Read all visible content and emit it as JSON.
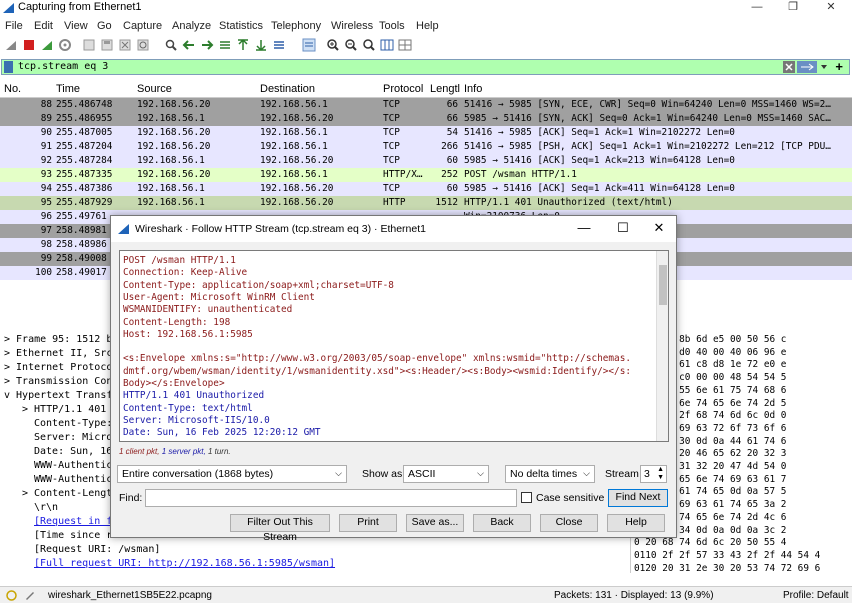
{
  "window": {
    "title": "Capturing from Ethernet1",
    "controls": [
      "—",
      "❐",
      "✕"
    ]
  },
  "menu": [
    "File",
    "Edit",
    "View",
    "Go",
    "Capture",
    "Analyze",
    "Statistics",
    "Telephony",
    "Wireless",
    "Tools",
    "Help"
  ],
  "toolbar_icons": [
    "shark-fin-icon",
    "stop-icon",
    "restart-icon",
    "options-gear-icon",
    "open-file-icon",
    "save-icon",
    "close-file-icon",
    "reload-icon",
    "find-icon",
    "back-icon",
    "forward-icon",
    "goto-icon",
    "first-icon",
    "last-icon",
    "autoscroll-icon",
    "colorize-icon",
    "zoom-in-icon",
    "zoom-out-icon",
    "zoom-normal-icon",
    "resize-columns-icon",
    "layout-icon"
  ],
  "filter": {
    "value": "tcp.stream eq 3",
    "plus": "+"
  },
  "columns": [
    "No.",
    "Time",
    "Source",
    "Destination",
    "Protocol",
    "Lengtl",
    "Info"
  ],
  "packets": [
    {
      "no": "88",
      "time": "255.486748",
      "src": "192.168.56.20",
      "dst": "192.168.56.1",
      "proto": "TCP",
      "len": "66",
      "info": "51416 → 5985 [SYN, ECE, CWR] Seq=0 Win=64240 Len=0 MSS=1460 WS=2…",
      "bg": "#a0a0a0"
    },
    {
      "no": "89",
      "time": "255.486955",
      "src": "192.168.56.1",
      "dst": "192.168.56.20",
      "proto": "TCP",
      "len": "66",
      "info": "5985 → 51416 [SYN, ACK] Seq=0 Ack=1 Win=64240 Len=0 MSS=1460 SAC…",
      "bg": "#a0a0a0"
    },
    {
      "no": "90",
      "time": "255.487005",
      "src": "192.168.56.20",
      "dst": "192.168.56.1",
      "proto": "TCP",
      "len": "54",
      "info": "51416 → 5985 [ACK] Seq=1 Ack=1 Win=2102272 Len=0",
      "bg": "#e7e6ff"
    },
    {
      "no": "91",
      "time": "255.487204",
      "src": "192.168.56.20",
      "dst": "192.168.56.1",
      "proto": "TCP",
      "len": "266",
      "info": "51416 → 5985 [PSH, ACK] Seq=1 Ack=1 Win=2102272 Len=212 [TCP PDU…",
      "bg": "#e7e6ff"
    },
    {
      "no": "92",
      "time": "255.487284",
      "src": "192.168.56.1",
      "dst": "192.168.56.20",
      "proto": "TCP",
      "len": "60",
      "info": "5985 → 51416 [ACK] Seq=1 Ack=213 Win=64128 Len=0",
      "bg": "#e7e6ff"
    },
    {
      "no": "93",
      "time": "255.487335",
      "src": "192.168.56.20",
      "dst": "192.168.56.1",
      "proto": "HTTP/X…",
      "len": "252",
      "info": "POST /wsman HTTP/1.1",
      "bg": "#e4ffc7"
    },
    {
      "no": "94",
      "time": "255.487386",
      "src": "192.168.56.1",
      "dst": "192.168.56.20",
      "proto": "TCP",
      "len": "60",
      "info": "5985 → 51416 [ACK] Seq=1 Ack=411 Win=64128 Len=0",
      "bg": "#e7e6ff"
    },
    {
      "no": "95",
      "time": "255.487929",
      "src": "192.168.56.1",
      "dst": "192.168.56.20",
      "proto": "HTTP",
      "len": "1512",
      "info": "HTTP/1.1 401 Unauthorized  (text/html)",
      "bg": "#c7d9b0"
    },
    {
      "no": "96",
      "time": "255.49761",
      "src": "",
      "dst": "",
      "proto": "",
      "len": "",
      "info": "Win=2100736 Len=0",
      "bg": "#e7e6ff"
    },
    {
      "no": "97",
      "time": "258.48981",
      "src": "",
      "dst": "",
      "proto": "",
      "len": "",
      "info": "=411 Win=64128 Len=0",
      "bg": "#a0a0a0"
    },
    {
      "no": "98",
      "time": "258.48986",
      "src": "",
      "dst": "",
      "proto": "",
      "len": "",
      "info": "Win=2100736 Len=0",
      "bg": "#e7e6ff"
    },
    {
      "no": "99",
      "time": "258.49008",
      "src": "",
      "dst": "",
      "proto": "",
      "len": "",
      "info": "1460 Win=2100736 Len=0",
      "bg": "#a0a0a0"
    },
    {
      "no": "100",
      "time": "258.49017",
      "src": "",
      "dst": "",
      "proto": "",
      "len": "",
      "info": "Win=64128 Len=0",
      "bg": "#e7e6ff"
    }
  ],
  "details": [
    {
      "t": "> Frame 95: 1512 b",
      "x": 4
    },
    {
      "t": "> Ethernet II, Src",
      "x": 4
    },
    {
      "t": "> Internet Protoco",
      "x": 4
    },
    {
      "t": "> Transmission Con",
      "x": 4
    },
    {
      "t": "v Hypertext Transf",
      "x": 4
    },
    {
      "t": "> HTTP/1.1 401",
      "x": 22
    },
    {
      "t": "Content-Type:",
      "x": 34
    },
    {
      "t": "Server: Micro",
      "x": 34
    },
    {
      "t": "Date: Sun, 16",
      "x": 34
    },
    {
      "t": "WWW-Authentic",
      "x": 34
    },
    {
      "t": "WWW-Authentic",
      "x": 34
    },
    {
      "t": "> Content-Lengt",
      "x": 22
    },
    {
      "t": "\\r\\n",
      "x": 34
    },
    {
      "t": "[Request in f",
      "x": 34,
      "link": true
    },
    {
      "t": "[Time since r",
      "x": 34
    },
    {
      "t": "[Request URI: /wsman]",
      "x": 34
    },
    {
      "t": "[Full request URI: http://192.168.56.1:5985/wsman]",
      "x": 34,
      "link": true
    }
  ],
  "hex": [
    "0 0c 29 8b 6d e5 00 50  56 c",
    "5 da ac d0 40 00 40 06  96 e",
    "8 14 17 61 c8 d8 1e 72  e0 e",
    "f f5 6d c0 00 00 48 54  54 5",
    "0 31 20 55 6e 61 75 74  68 6",
    "a 43 6f 6e 74 65 6e 74  2d 5",
    "5 78 74 2f 68 74 6d 6c  0d 0",
    "a 20 4d 69 63 72 6f 73  6f 6",
    "0 30 2e 30 0d 0a 44 61  74 6",
    "0 31 36 20 46 65 62 20  32 3",
    "2 30 3a 31 32 20 47 4d  54 0",
    "5 74 68 65 6e 74 69 63  61 7",
    "4 74 69 61 74 65 0d 0a  57 5",
    "5 6e 74 69 63 61 74 65  3a 2",
    "a 6f 6e 74 65 6e 74 2d  4c 6",
    "1 32 36 34 0d 0a 0d 0a  3c 2",
    "0 20 68 74 6d 6c 20 50  55 4",
    "0110  2f 2f 57 33 43 2f 2f 44  54 4",
    "0120  20 31 2e 30 20 53 74 72  69 6"
  ],
  "status": {
    "file": "wireshark_Ethernet1SB5E22.pcapng",
    "packets": "Packets: 131 · Displayed: 13 (9.9%)",
    "profile": "Profile: Default"
  },
  "dialog": {
    "title": "Wireshark · Follow HTTP Stream (tcp.stream eq 3) · Ethernet1",
    "lines": [
      {
        "t": "POST /wsman HTTP/1.1",
        "c": "cl"
      },
      {
        "t": "Connection: Keep-Alive",
        "c": "cl"
      },
      {
        "t": "Content-Type: application/soap+xml;charset=UTF-8",
        "c": "cl"
      },
      {
        "t": "User-Agent: Microsoft WinRM Client",
        "c": "cl"
      },
      {
        "t": "WSMANIDENTIFY: unauthenticated",
        "c": "cl"
      },
      {
        "t": "Content-Length: 198",
        "c": "cl"
      },
      {
        "t": "Host: 192.168.56.1:5985",
        "c": "cl"
      },
      {
        "t": "",
        "c": "cl"
      },
      {
        "t": "<s:Envelope xmlns:s=\"http://www.w3.org/2003/05/soap-envelope\" xmlns:wsmid=\"http://schemas.",
        "c": "cl"
      },
      {
        "t": "dmtf.org/wbem/wsman/identity/1/wsmanidentity.xsd\"><s:Header/><s:Body><wsmid:Identify/></s:",
        "c": "cl"
      },
      {
        "t": "Body></s:Envelope>",
        "c": "cl"
      },
      {
        "t": "HTTP/1.1 401 Unauthorized",
        "c": "sv"
      },
      {
        "t": "Content-Type: text/html",
        "c": "sv"
      },
      {
        "t": "Server: Microsoft-IIS/10.0",
        "c": "sv"
      },
      {
        "t": "Date: Sun, 16 Feb 2025 12:20:12 GMT",
        "c": "sv"
      }
    ],
    "pkt_summary_client": "1 client pkt,",
    "pkt_summary_server": "1 server pkt,",
    "pkt_summary_turn": "1 turn.",
    "conversation": "Entire conversation (1868 bytes)",
    "show_as_label": "Show as",
    "show_as": "ASCII",
    "delta": "No delta times",
    "stream_label": "Stream",
    "stream": "3",
    "find_label": "Find:",
    "find_value": "",
    "case_label": "Case sensitive",
    "find_next": "Find Next",
    "buttons": [
      "Filter Out This Stream",
      "Print",
      "Save as...",
      "Back",
      "Close",
      "Help"
    ]
  }
}
